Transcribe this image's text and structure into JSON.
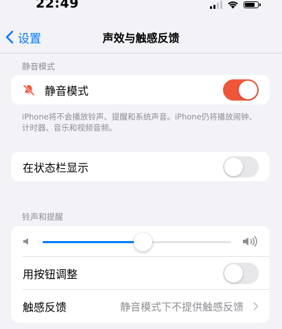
{
  "status_bar": {
    "time": "22:49",
    "battery_level": 0.85
  },
  "nav": {
    "back_label": "设置",
    "title": "声效与触感反馈"
  },
  "silent_section": {
    "header": "静音模式",
    "row_label": "静音模式",
    "toggle_on": true,
    "footnote": "iPhone将不会播放铃声、提醒和系统声音。iPhone仍将播放闹钟、计时器、音乐和视频音频。"
  },
  "status_bar_row": {
    "label": "在状态栏显示",
    "toggle_on": false
  },
  "ringtone_section": {
    "header": "铃声和提醒",
    "volume_level": 0.53,
    "adjust_with_buttons_label": "用按钮调整",
    "adjust_with_buttons_on": false,
    "haptics_label": "触感反馈",
    "haptics_value": "静音模式下不提供触感反馈"
  },
  "colors": {
    "accent": "#007aff",
    "toggle_on": "#f0553a",
    "background": "#f2f2f7"
  },
  "icons": {
    "back": "chevron-left-icon",
    "silent": "bell-slash-icon",
    "volume_low": "speaker-icon",
    "volume_high": "speaker-wave-icon",
    "disclosure": "chevron-right-icon"
  }
}
